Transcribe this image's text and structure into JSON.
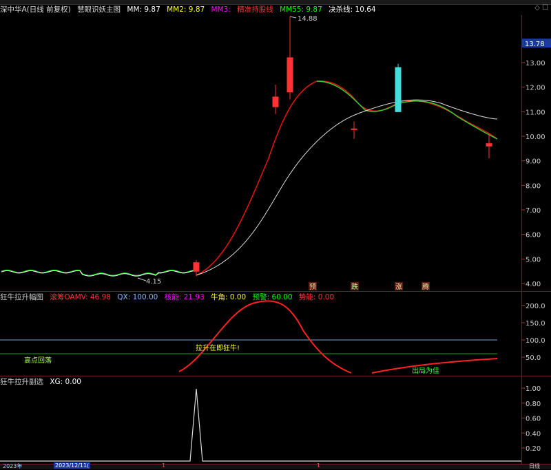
{
  "window": {
    "title": "深中华A(日线 前复权)",
    "indicator": "慧眼识妖主图",
    "controls": "◇ ☐"
  },
  "legend_main": [
    {
      "label": "MM: 9.87",
      "color": "#ffffff"
    },
    {
      "label": "MM2: 9.87",
      "color": "#ffff00"
    },
    {
      "label": "MM3:",
      "color": "#ff00ff"
    },
    {
      "label": "精准持股线",
      "color": "#ff3333"
    },
    {
      "label": "MM55: 9.87",
      "color": "#00ff00"
    },
    {
      "label": "决杀线: 10.64",
      "color": "#ffffff"
    }
  ],
  "panel2": {
    "title": "狂牛拉升幅图",
    "legend": [
      {
        "label": "滚筹OAMV: 46.98",
        "color": "#ff3333"
      },
      {
        "label": "QX: 100.00",
        "color": "#88bbff"
      },
      {
        "label": "核能: 21.93",
        "color": "#ff00ff"
      },
      {
        "label": "牛角: 0.00",
        "color": "#ffff00"
      },
      {
        "label": "预警: 60.00",
        "color": "#00ff00"
      },
      {
        "label": "势能: 0.00",
        "color": "#ff3333"
      }
    ],
    "annotations": {
      "high_callback": "高点回落",
      "surge": "拉升在即狂牛!",
      "exit": "出局为佳"
    }
  },
  "panel3": {
    "title": "狂牛拉升副选",
    "legend": [
      {
        "label": "XG: 0.00",
        "color": "#ffffff"
      }
    ]
  },
  "bottom": {
    "dates": [
      "2023年",
      "2023/12/11(",
      "1",
      "1"
    ],
    "period": "日线"
  },
  "chart_data": [
    {
      "type": "candlestick",
      "title": "慧眼识妖主图",
      "price_axis": {
        "ticks": [
          13.0,
          12.0,
          11.0,
          10.0,
          9.0,
          8.0,
          7.0,
          6.0,
          5.0,
          4.0
        ],
        "current": "13.78"
      },
      "annotations": {
        "high": "14.88",
        "low": "4.15"
      },
      "signal_labels": [
        "预",
        "跌",
        "涨",
        "腾"
      ],
      "candles": [
        {
          "open": 4.5,
          "high": 4.95,
          "low": 4.3,
          "close": 4.85
        },
        {
          "open": 11.2,
          "high": 12.1,
          "low": 10.9,
          "close": 11.6
        },
        {
          "open": 11.8,
          "high": 14.88,
          "low": 11.5,
          "close": 13.2
        },
        {
          "open": 12.8,
          "high": 12.95,
          "low": 11.0,
          "close": 11.0
        },
        {
          "open": 10.3,
          "high": 10.6,
          "low": 9.9,
          "close": 10.3
        },
        {
          "open": 9.6,
          "high": 10.1,
          "low": 9.1,
          "close": 9.7
        }
      ]
    },
    {
      "type": "line",
      "title": "狂牛拉升幅图",
      "y_ticks": [
        200.0,
        150.0,
        100.0,
        50.0
      ]
    },
    {
      "type": "line",
      "title": "狂牛拉升副选",
      "y_ticks": [
        1.0,
        0.8,
        0.6,
        0.4,
        0.2
      ]
    }
  ]
}
